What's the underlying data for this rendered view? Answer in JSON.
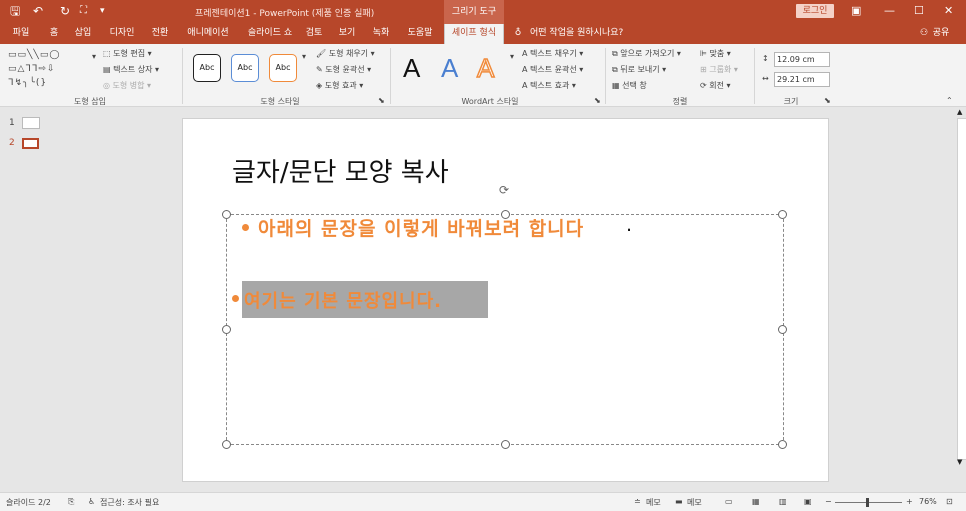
{
  "titlebar": {
    "title": "프레젠테이션1 - PowerPoint (제품 인증 실패)",
    "context_tool": "그리기 도구",
    "login_label": "로그인",
    "qa_icons": [
      "save-icon",
      "undo-icon",
      "redo-icon",
      "customize-icon"
    ]
  },
  "tabs": [
    {
      "label": "파일"
    },
    {
      "label": "홈"
    },
    {
      "label": "삽입"
    },
    {
      "label": "디자인"
    },
    {
      "label": "전환"
    },
    {
      "label": "애니메이션"
    },
    {
      "label": "슬라이드 쇼"
    },
    {
      "label": "검토"
    },
    {
      "label": "보기"
    },
    {
      "label": "녹화"
    },
    {
      "label": "도움말"
    },
    {
      "label": "셰이프 형식"
    }
  ],
  "tell_me": "어떤 작업을 원하시나요?",
  "share_label": "공유",
  "ribbon": {
    "insert_shapes": {
      "edit_shape": "도형 편집",
      "text_box": "텍스트 상자",
      "merge_shapes": "도형 병합",
      "group_label": "도형 삽입"
    },
    "shape_styles": {
      "samples": [
        "Abc",
        "Abc",
        "Abc"
      ],
      "fill": "도형 채우기",
      "outline": "도형 윤곽선",
      "effects": "도형 효과",
      "group_label": "도형 스타일"
    },
    "wordart": {
      "letters": [
        "A",
        "A",
        "A"
      ],
      "text_fill": "텍스트 채우기",
      "text_outline": "텍스트 윤곽선",
      "text_effects": "텍스트 효과",
      "group_label": "WordArt 스타일"
    },
    "arrange": {
      "bring_forward": "앞으로 가져오기",
      "send_backward": "뒤로 보내기",
      "selection_pane": "선택 창",
      "align": "맞춤",
      "group": "그룹화",
      "rotate": "회전",
      "group_label": "정렬"
    },
    "size": {
      "height": "12.09 cm",
      "width": "29.21 cm",
      "group_label": "크기"
    }
  },
  "thumbnails": [
    {
      "num": "1"
    },
    {
      "num": "2"
    }
  ],
  "slide": {
    "title": "글자/문단 모양 복사",
    "line1": "아래의 문장을 이렇게 바꿔보려 합니다",
    "line1_end": ".",
    "line2": "여기는 기본 문장입니다."
  },
  "status": {
    "slide_info": "슬라이드 2/2",
    "accessibility": "접근성: 조사 필요",
    "notes": "메모",
    "comments": "메모",
    "zoom": "76%"
  },
  "colors": {
    "accent": "#b7472a",
    "bullet_orange": "#f08a3a",
    "highlight_gray": "#a7a7a7"
  }
}
